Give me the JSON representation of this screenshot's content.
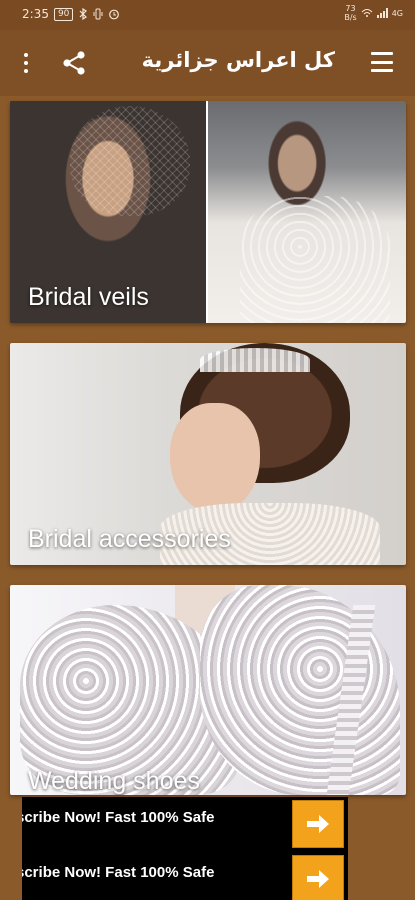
{
  "status_bar": {
    "time": "2:35",
    "battery": "90",
    "net_speed_top": "73",
    "net_speed_bottom": "B/s",
    "network_type": "4G"
  },
  "app_bar": {
    "title": "كل اعراس جزائرية",
    "icons": [
      "more-vert-icon",
      "share-icon",
      "menu-icon"
    ]
  },
  "cards": [
    {
      "label": "Bridal veils"
    },
    {
      "label": "Bridal accessories"
    },
    {
      "label": "Wedding shoes"
    }
  ],
  "ad": {
    "rows": [
      {
        "text": "scribe Now! Fast 100% Safe"
      },
      {
        "text": "scribe Now! Fast 100% Safe"
      }
    ],
    "button_icon": "arrow-right-icon",
    "button_color": "#f2a31b"
  },
  "colors": {
    "background": "#8b5a2b",
    "app_bar": "#7f4f26",
    "status_bar": "#7a4a22"
  }
}
